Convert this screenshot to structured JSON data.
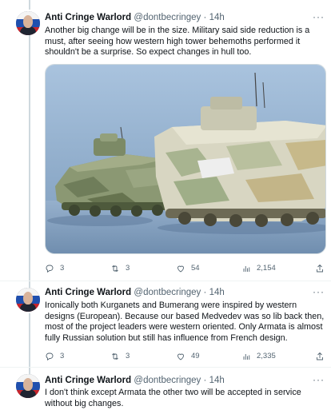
{
  "tweets": [
    {
      "name": "Anti Cringe Warlord",
      "handle": "@dontbecringey",
      "dot": "·",
      "time": "14h",
      "text": "Another big change will be in the size. Military said side reduction is a must, after seeing how western high tower behemoths performed it shouldn't be a surprise. So expect changes in hull too.",
      "media": "two-armored-vehicles-model-photo",
      "actions": {
        "replies": "3",
        "retweets": "3",
        "likes": "54",
        "views": "2,154"
      }
    },
    {
      "name": "Anti Cringe Warlord",
      "handle": "@dontbecringey",
      "dot": "·",
      "time": "14h",
      "text": "Ironically both Kurganets and Bumerang were inspired by western designs (European). Because our based Medvedev was so lib back then, most of the project leaders were western oriented. Only Armata is almost fully Russian solution but still has influence from French design.",
      "actions": {
        "replies": "3",
        "retweets": "3",
        "likes": "49",
        "views": "2,335"
      }
    },
    {
      "name": "Anti Cringe Warlord",
      "handle": "@dontbecringey",
      "dot": "·",
      "time": "14h",
      "text": "I don't think except Armata the other two will be accepted in service without big changes."
    }
  ],
  "icons": {
    "reply": "reply-icon",
    "retweet": "retweet-icon",
    "like": "heart-icon",
    "views": "views-icon",
    "share": "share-icon",
    "more": "more-icon"
  },
  "colors": {
    "text": "#0f1419",
    "secondary": "#536471",
    "divider": "#eff3f4"
  }
}
